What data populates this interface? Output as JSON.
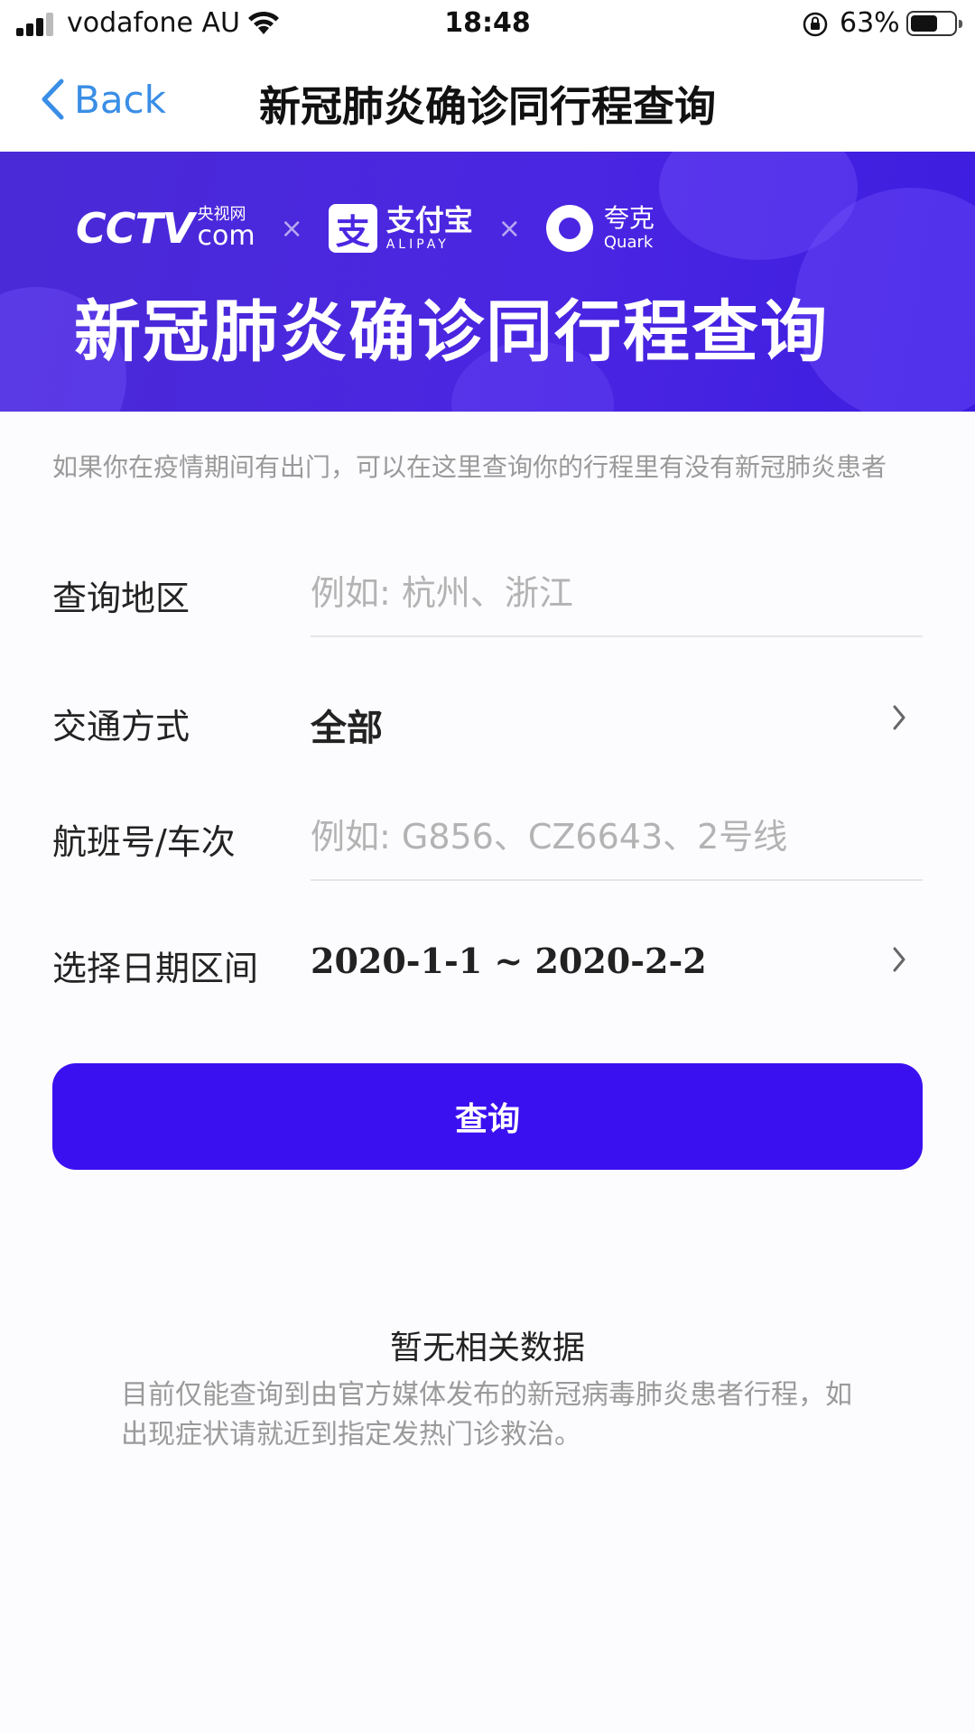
{
  "status_bar": {
    "carrier": "vodafone AU",
    "time": "18:48",
    "battery_percent": "63%",
    "battery_level": 0.63,
    "icons": [
      "signal-icon",
      "wifi-icon",
      "orientation-lock-icon",
      "battery-icon"
    ]
  },
  "nav": {
    "back_label": "Back",
    "title": "新冠肺炎确诊同行程查询"
  },
  "banner": {
    "cctv_logo": "CCTV",
    "cctv_cn": "央视网",
    "cctv_com": "com",
    "times_symbol": "×",
    "alipay_icon_glyph": "支",
    "alipay_cn": "支付宝",
    "alipay_en": "ALIPAY",
    "quark_cn": "夸克",
    "quark_en": "Quark",
    "title": "新冠肺炎确诊同行程查询",
    "colors": {
      "background": "#4b26e2",
      "text": "#ffffff"
    }
  },
  "intro_text": "如果你在疫情期间有出门，可以在这里查询你的行程里有没有新冠肺炎患者",
  "form": {
    "region": {
      "label": "查询地区",
      "value": "",
      "placeholder": "例如: 杭州、浙江"
    },
    "transport": {
      "label": "交通方式",
      "value": "全部"
    },
    "flight": {
      "label": "航班号/车次",
      "value": "",
      "placeholder": "例如: G856、CZ6643、2号线"
    },
    "date_range": {
      "label": "选择日期区间",
      "value": "2020-1-1 ~ 2020-2-2"
    }
  },
  "query_button": {
    "label": "查询",
    "color": "#3b10f0"
  },
  "empty_state": {
    "title": "暂无相关数据",
    "description": "目前仅能查询到由官方媒体发布的新冠病毒肺炎患者行程，如出现症状请就近到指定发热门诊救治。"
  }
}
